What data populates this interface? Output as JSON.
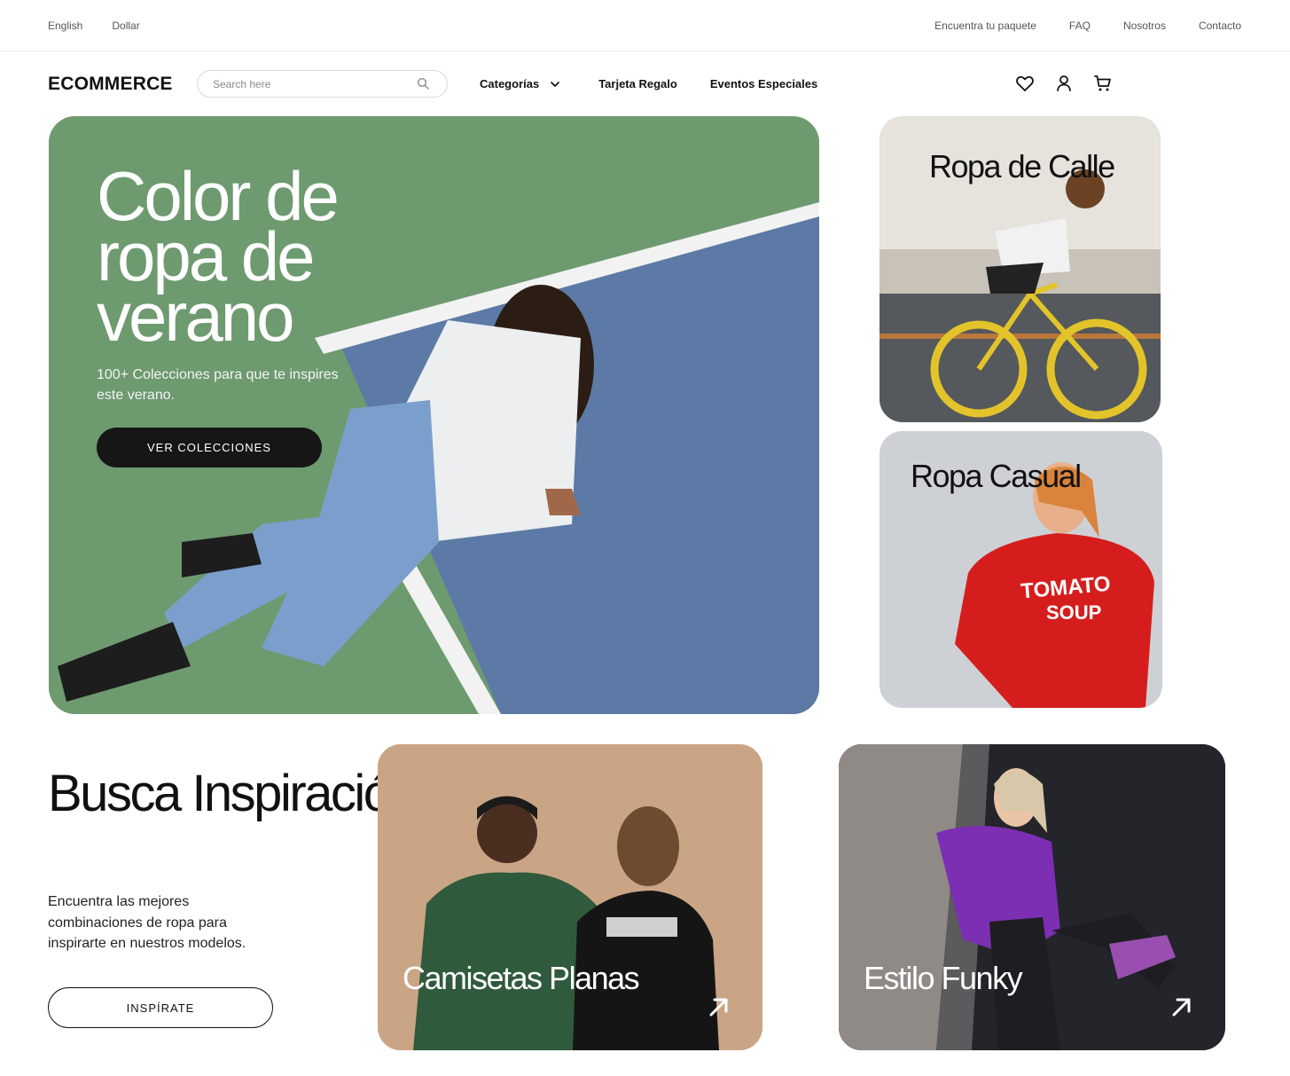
{
  "topbar": {
    "language": "English",
    "currency": "Dollar",
    "links": [
      "Encuentra tu paquete",
      "FAQ",
      "Nosotros",
      "Contacto"
    ]
  },
  "header": {
    "logo": "ECOMMERCE",
    "search_placeholder": "Search here",
    "nav": {
      "categories": "Categorías",
      "gift_card": "Tarjeta Regalo",
      "events": "Eventos Especiales"
    },
    "icons": [
      "heart-icon",
      "user-icon",
      "cart-icon"
    ]
  },
  "hero": {
    "title": "Color de ropa de verano",
    "subtitle": "100+ Colecciones para que te inspires este verano.",
    "button": "VER COLECCIONES"
  },
  "categories": [
    {
      "title": "Ropa de Calle"
    },
    {
      "title": "Ropa Casual"
    }
  ],
  "inspiration": {
    "title": "Busca Inspiración",
    "text": "Encuentra las mejores combinaciones de ropa para inspirarte en nuestros modelos.",
    "button": "INSPÍRATE"
  },
  "collections": [
    {
      "title": "Camisetas Planas"
    },
    {
      "title": "Estilo Funky"
    }
  ],
  "colors": {
    "text": "#111111",
    "button_dark": "#161616",
    "court_green": "#6e9a70",
    "court_blue": "#5d7aa6"
  }
}
